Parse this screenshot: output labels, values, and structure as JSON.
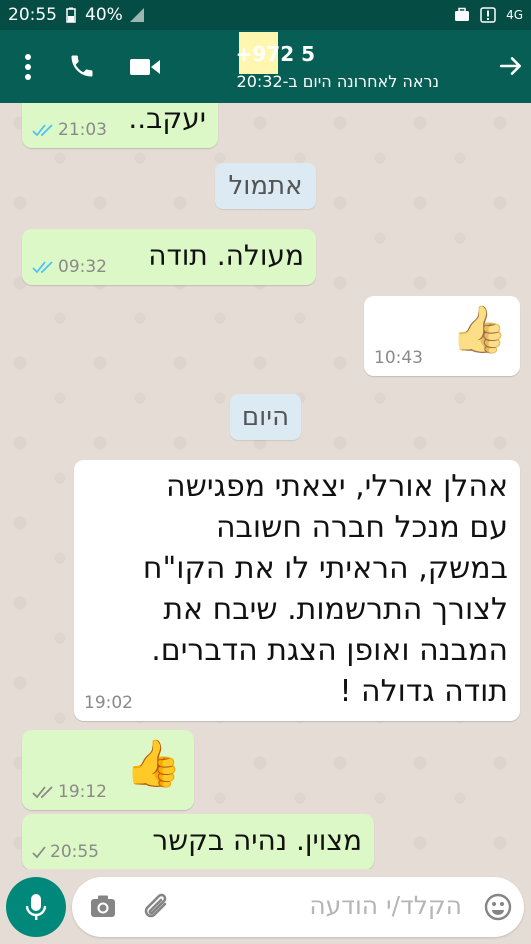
{
  "status_bar": {
    "time": "20:55",
    "battery": "40%",
    "network": "4G"
  },
  "header": {
    "contact_name": "+972 5",
    "last_seen": "נראה לאחרונה היום ב-20:32"
  },
  "messages": [
    {
      "text": "יעקב..",
      "time": "21:03",
      "direction": "outgoing",
      "status": "read"
    },
    {
      "text": "מעולה. תודה",
      "time": "09:32",
      "direction": "outgoing",
      "status": "read"
    },
    {
      "text": "👍",
      "time": "10:43",
      "direction": "incoming"
    },
    {
      "lines": [
        "אהלן אורלי, יצאתי מפגישה",
        "עם מנכל חברה חשובה",
        "במשק, הראיתי לו את הקו\"ח",
        "לצורך התרשמות. שיבח את",
        "המבנה ואופן הצגת הדברים.",
        "תודה גדולה !"
      ],
      "time": "19:02",
      "direction": "incoming"
    },
    {
      "text": "👍",
      "time": "19:12",
      "direction": "outgoing",
      "status": "delivered"
    },
    {
      "text": "מצוין. נהיה בקשר",
      "time": "20:55",
      "direction": "outgoing",
      "status": "sent"
    }
  ],
  "date_separators": {
    "yesterday": "אתמול",
    "today": "היום"
  },
  "input": {
    "placeholder": "הקלד/י הודעה"
  },
  "colors": {
    "header": "#075e54",
    "status_bar": "#054d44",
    "outgoing_bubble": "#dcf8c6",
    "incoming_bubble": "#ffffff",
    "read_tick": "#4fc3f7",
    "mic_button": "#00897b"
  },
  "icons": {
    "menu": "more-vert-icon",
    "call": "phone-icon",
    "video": "video-icon",
    "back": "arrow-icon",
    "mic": "mic-icon",
    "camera": "camera-icon",
    "attach": "paperclip-icon",
    "emoji": "emoji-icon"
  }
}
